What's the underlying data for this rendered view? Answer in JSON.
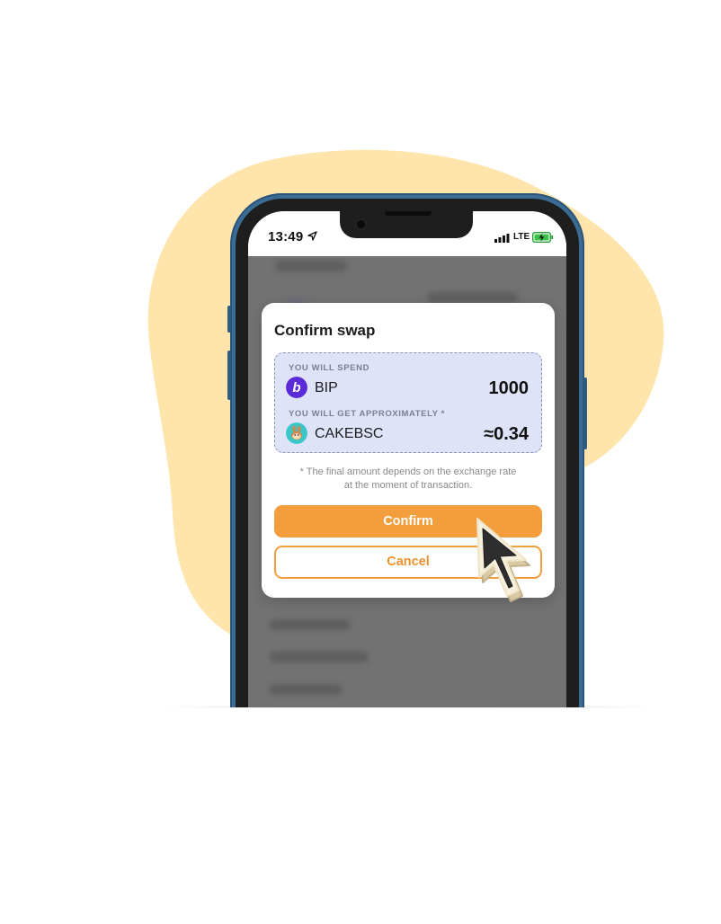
{
  "status_bar": {
    "time": "13:49",
    "network": "LTE"
  },
  "modal": {
    "title": "Confirm swap",
    "spend": {
      "label": "YOU WILL SPEND",
      "coin": "BIP",
      "amount": "1000"
    },
    "receive": {
      "label": "YOU WILL GET APPROXIMATELY *",
      "coin": "CAKEBSC",
      "amount": "≈0.34"
    },
    "note_line1": "* The final amount depends on the exchange rate",
    "note_line2": "at the moment of transaction.",
    "confirm_label": "Confirm",
    "cancel_label": "Cancel"
  },
  "icons": {
    "bip_coin": "bip-coin-icon",
    "cake_coin": "pancake-bunny-icon",
    "cursor": "mouse-pointer-icon",
    "location": "location-arrow-icon",
    "signal": "signal-bars-icon",
    "battery": "battery-charging-icon"
  },
  "colors": {
    "accent": "#f29e3d",
    "swap_box_bg": "#dfe3f8",
    "blob": "#ffe4ac",
    "phone_frame": "#3a6c96",
    "bip_purple": "#5a2bd6",
    "cake_teal": "#3bc7c9"
  }
}
